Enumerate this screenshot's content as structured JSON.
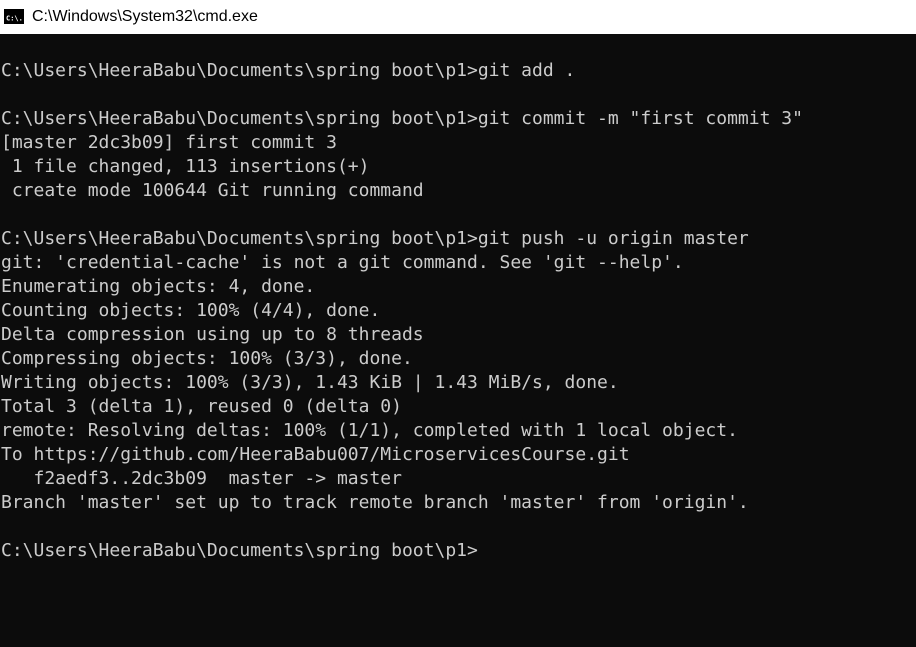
{
  "window": {
    "title": "C:\\Windows\\System32\\cmd.exe",
    "icon": "cmd-icon",
    "icon_text": "C:\\."
  },
  "colors": {
    "background": "#0c0c0c",
    "text": "#cccccc",
    "titlebar": "#ffffff"
  },
  "console": {
    "lines": [
      "C:\\Users\\HeeraBabu\\Documents\\spring boot\\p1>git add .",
      "",
      "C:\\Users\\HeeraBabu\\Documents\\spring boot\\p1>git commit -m \"first commit 3\"",
      "[master 2dc3b09] first commit 3",
      " 1 file changed, 113 insertions(+)",
      " create mode 100644 Git running command",
      "",
      "C:\\Users\\HeeraBabu\\Documents\\spring boot\\p1>git push -u origin master",
      "git: 'credential-cache' is not a git command. See 'git --help'.",
      "Enumerating objects: 4, done.",
      "Counting objects: 100% (4/4), done.",
      "Delta compression using up to 8 threads",
      "Compressing objects: 100% (3/3), done.",
      "Writing objects: 100% (3/3), 1.43 KiB | 1.43 MiB/s, done.",
      "Total 3 (delta 1), reused 0 (delta 0)",
      "remote: Resolving deltas: 100% (1/1), completed with 1 local object.",
      "To https://github.com/HeeraBabu007/MicroservicesCourse.git",
      "   f2aedf3..2dc3b09  master -> master",
      "Branch 'master' set up to track remote branch 'master' from 'origin'.",
      "",
      "C:\\Users\\HeeraBabu\\Documents\\spring boot\\p1>"
    ]
  }
}
